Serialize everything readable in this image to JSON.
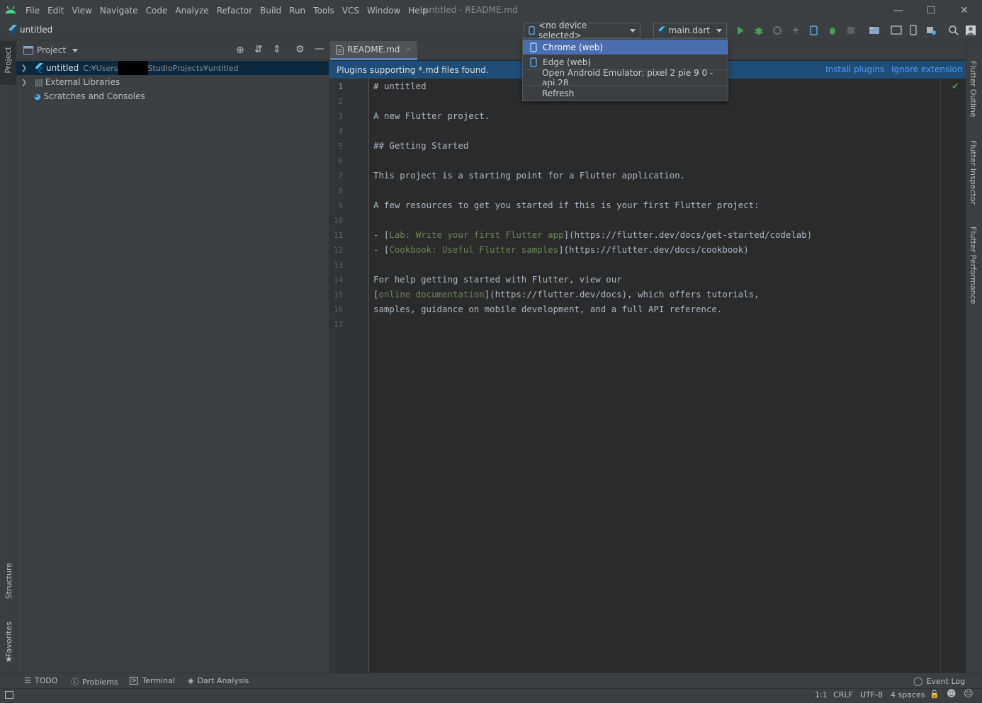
{
  "colors": {
    "accent": "#4b6eaf",
    "banner": "#1e4d78",
    "link": "#589df6",
    "flutter": "#54c5f8",
    "run_green": "#499c54",
    "markdown_link": "#6a8759"
  },
  "menu": {
    "items": [
      "File",
      "Edit",
      "View",
      "Navigate",
      "Code",
      "Analyze",
      "Refactor",
      "Build",
      "Run",
      "Tools",
      "VCS",
      "Window",
      "Help"
    ]
  },
  "window_title": "untitled - README.md",
  "navbar": {
    "project": "untitled",
    "device_selector": "<no device selected>",
    "run_config": "main.dart"
  },
  "device_dropdown": {
    "items": [
      {
        "label": "Chrome (web)",
        "icon": "phone-icon",
        "selected": true
      },
      {
        "label": "Edge (web)",
        "icon": "phone-icon",
        "selected": false
      },
      {
        "label": "Open Android Emulator: pixel 2 pie 9 0 - api 28",
        "icon": "",
        "selected": false
      },
      {
        "label": "Refresh",
        "icon": "",
        "selected": false
      }
    ]
  },
  "left_stripe": {
    "project": "Project",
    "structure": "Structure",
    "favorites": "Favorites"
  },
  "right_stripe": {
    "outline": "Flutter Outline",
    "inspector": "Flutter Inspector",
    "performance": "Flutter Performance"
  },
  "project_panel": {
    "title": "Project",
    "tree": [
      {
        "label": "untitled",
        "path_start": "C:¥Users",
        "path_end": "StudioProjects¥untitled",
        "expanded": false
      },
      {
        "label": "External Libraries"
      },
      {
        "label": "Scratches and Consoles"
      }
    ]
  },
  "editor": {
    "tab": "README.md",
    "banner": {
      "text": "Plugins supporting *.md files found.",
      "install": "Install plugins",
      "ignore": "Ignore extension"
    },
    "line_numbers": [
      "1",
      "2",
      "3",
      "4",
      "5",
      "6",
      "7",
      "8",
      "9",
      "10",
      "11",
      "12",
      "13",
      "14",
      "15",
      "16",
      "17"
    ],
    "lines": {
      "l1": "# untitled",
      "l3": "A new Flutter project.",
      "l5": "## Getting Started",
      "l7": "This project is a starting point for a Flutter application.",
      "l9": "A few resources to get you started if this is your first Flutter project:",
      "l11_pre": "- [",
      "l11_link": "Lab: Write your first Flutter app",
      "l11_post": "](https://flutter.dev/docs/get-started/codelab)",
      "l12_pre": "- [",
      "l12_link": "Cookbook: Useful Flutter samples",
      "l12_post": "](https://flutter.dev/docs/cookbook)",
      "l14": "For help getting started with Flutter, view our",
      "l15_pre": "[",
      "l15_link": "online documentation",
      "l15_post": "](https://flutter.dev/docs), which offers tutorials,",
      "l16": "samples, guidance on mobile development, and a full API reference."
    }
  },
  "bottom_tabs": {
    "todo": "TODO",
    "problems": "Problems",
    "terminal": "Terminal",
    "dart_analysis": "Dart Analysis",
    "event_log": "Event Log"
  },
  "status": {
    "position": "1:1",
    "line_sep": "CRLF",
    "encoding": "UTF-8",
    "indent": "4 spaces"
  }
}
